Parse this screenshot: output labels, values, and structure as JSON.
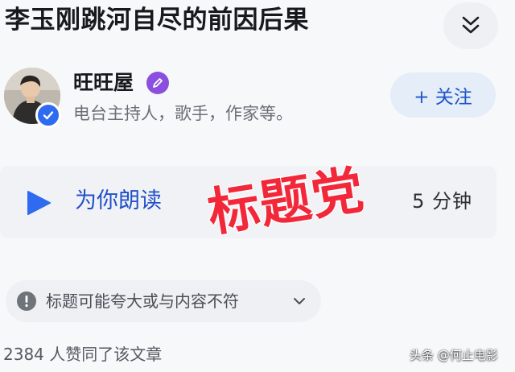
{
  "article": {
    "title": "李玉刚跳河自尽的前因后果"
  },
  "header": {
    "collapse_icon": "double-chevron-down-icon"
  },
  "author": {
    "name": "旺旺屋",
    "description": "电台主持人，歌手，作家等。",
    "badge_icon": "pen-icon",
    "verified_icon": "verified-check-icon",
    "follow_label": "+ 关注"
  },
  "read_aloud": {
    "label": "为你朗读",
    "duration": "5 分钟",
    "icon": "play-icon"
  },
  "stamp": {
    "text": "标题党",
    "color": "#f2283a"
  },
  "warning": {
    "text": "标题可能夸大或与内容不符",
    "icon": "alert-icon",
    "expand_icon": "chevron-down-icon"
  },
  "stats": {
    "likes_text": "2384 人赞同了该文章"
  },
  "watermark": {
    "text": "头条 @何止电影"
  },
  "colors": {
    "accent_blue": "#2151c9",
    "verified_blue": "#2f6bf0",
    "creator_purple": "#8b4fe0",
    "stamp_red": "#f2283a"
  }
}
